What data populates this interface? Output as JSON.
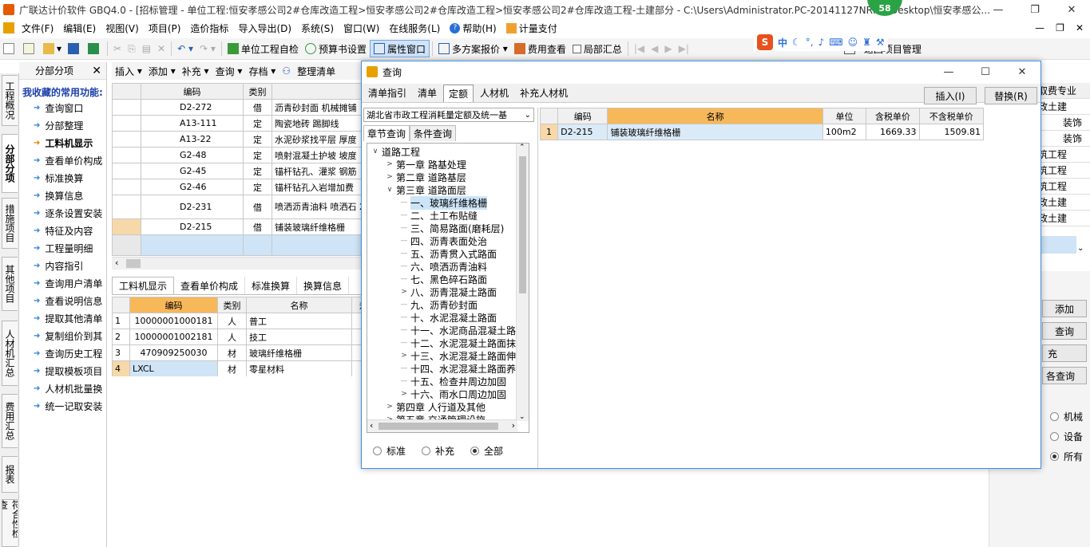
{
  "window": {
    "title": "广联达计价软件 GBQ4.0 - [招标管理 - 单位工程:恒安孝感公司2#仓库改造工程>恒安孝感公司2#仓库改造工程>恒安孝感公司2#仓库改造工程-土建部分 - C:\\Users\\Administrator.PC-20141127NRHN\\Desktop\\恒安孝感公...",
    "badge": "58",
    "minimize": "—",
    "restore": "❐",
    "close": "✕"
  },
  "menubar": {
    "items": [
      "文件(F)",
      "编辑(E)",
      "视图(V)",
      "项目(P)",
      "造价指标",
      "导入导出(D)",
      "系统(S)",
      "窗口(W)",
      "在线服务(L)",
      "帮助(H)",
      "计量支付"
    ],
    "right": [
      "—",
      "❐",
      "✕"
    ]
  },
  "toolbar": {
    "self_check": "单位工程自检",
    "budget_settings": "预算书设置",
    "property_window": "属性窗口",
    "multi_plan": "多方案报价",
    "fee_view": "费用查看",
    "partial_sum": "局部汇总",
    "back_project": "返回项目管理",
    "ime": "中"
  },
  "vtabs": [
    "工程概况",
    "分部分项",
    "措施项目",
    "其他项目",
    "人材机汇总",
    "费用汇总",
    "报表",
    "符合性检查"
  ],
  "leftpanel": {
    "header": "分部分项",
    "fav_title": "我收藏的常用功能:",
    "items": [
      "查询窗口",
      "分部整理",
      "工料机显示",
      "查看单价构成",
      "标准换算",
      "换算信息",
      "逐条设置安装",
      "特征及内容",
      "工程量明细",
      "内容指引",
      "查询用户清单",
      "查看说明信息",
      "提取其他清单",
      "复制组价到其",
      "查询历史工程",
      "提取模板项目",
      "人材机批量换",
      "统一记取安装"
    ]
  },
  "subtoolbar": [
    "插入",
    "添加",
    "补充",
    "查询",
    "存档",
    "整理清单"
  ],
  "main_grid": {
    "headers": [
      "编码",
      "类别",
      "名"
    ],
    "rows": [
      {
        "code": "D2-272",
        "type": "借",
        "name": "沥青砂封面 机械摊铺"
      },
      {
        "code": "A13-111",
        "type": "定",
        "name": "陶瓷地砖 踢脚线"
      },
      {
        "code": "A13-22",
        "type": "定",
        "name": "水泥砂浆找平层 厚度"
      },
      {
        "code": "G2-48",
        "type": "定",
        "name": "喷射混凝土护坡 坡度"
      },
      {
        "code": "G2-45",
        "type": "定",
        "name": "锚杆钻孔、灌浆 钢筋"
      },
      {
        "code": "G2-46",
        "type": "定",
        "name": "锚杆钻孔入岩增加费"
      },
      {
        "code": "D2-231",
        "type": "借",
        "name": "喷洒沥青油料 喷洒石 2)"
      },
      {
        "code": "D2-215",
        "type": "借",
        "name": "铺装玻璃纤维格栅"
      }
    ]
  },
  "bottom_tabs": [
    "工料机显示",
    "查看单价构成",
    "标准换算",
    "换算信息"
  ],
  "bottom_grid": {
    "headers": [
      "编码",
      "类别",
      "名称",
      "规"
    ],
    "rows": [
      {
        "no": "1",
        "code": "10000001000181",
        "type": "人",
        "name": "普工"
      },
      {
        "no": "2",
        "code": "10000001002181",
        "type": "人",
        "name": "技工"
      },
      {
        "no": "3",
        "code": "470909250030",
        "type": "材",
        "name": "玻璃纤维格栅"
      },
      {
        "no": "4",
        "code": "LXCL",
        "type": "材",
        "name": "零星材料"
      }
    ]
  },
  "rightpanel": {
    "col_items": [
      "取费专业",
      "政土建",
      "装饰",
      "装饰",
      "筑工程",
      "筑工程",
      "筑工程",
      "政土建",
      "政土建"
    ],
    "buttons": [
      "添加",
      "查询",
      "充",
      "各查询"
    ],
    "radios": [
      "机械",
      "设备",
      "所有"
    ]
  },
  "dialog": {
    "title": "查询",
    "tabs": [
      "清单指引",
      "清单",
      "定额",
      "人材机",
      "补充人材机"
    ],
    "insert_btn": "插入(I)",
    "replace_btn": "替换(R)",
    "combo": "湖北省市政工程消耗量定额及统一基",
    "subtabs": [
      "章节查询",
      "条件查询"
    ],
    "tree": [
      "道路工程",
      "第一章  路基处理",
      "第二章  道路基层",
      "第三章  道路面层",
      "一、玻璃纤维格栅",
      "二、土工布贴缝",
      "三、简易路面(磨耗层)",
      "四、沥青表面处治",
      "五、沥青贯入式路面",
      "六、喷洒沥青油料",
      "七、黑色碎石路面",
      "八、沥青混凝土路面",
      "九、沥青砂封面",
      "十、水泥混凝土路面",
      "十一、水泥商品混凝土路",
      "十二、水泥混凝土路面抹",
      "十三、水泥混凝土路面伸",
      "十四、水泥混凝土路面养",
      "十五、检查井周边加固",
      "十六、雨水口周边加固",
      "第四章  人行道及其他",
      "第五章  交通管理设施"
    ],
    "radios": [
      "标准",
      "补充",
      "全部"
    ],
    "result_headers": [
      "编码",
      "名称",
      "单位",
      "含税单价",
      "不含税单价"
    ],
    "result_rows": [
      {
        "no": "1",
        "code": "D2-215",
        "name": "铺装玻璃纤维格栅",
        "unit": "100m2",
        "tax_price": "1669.33",
        "notax_price": "1509.81"
      }
    ]
  }
}
